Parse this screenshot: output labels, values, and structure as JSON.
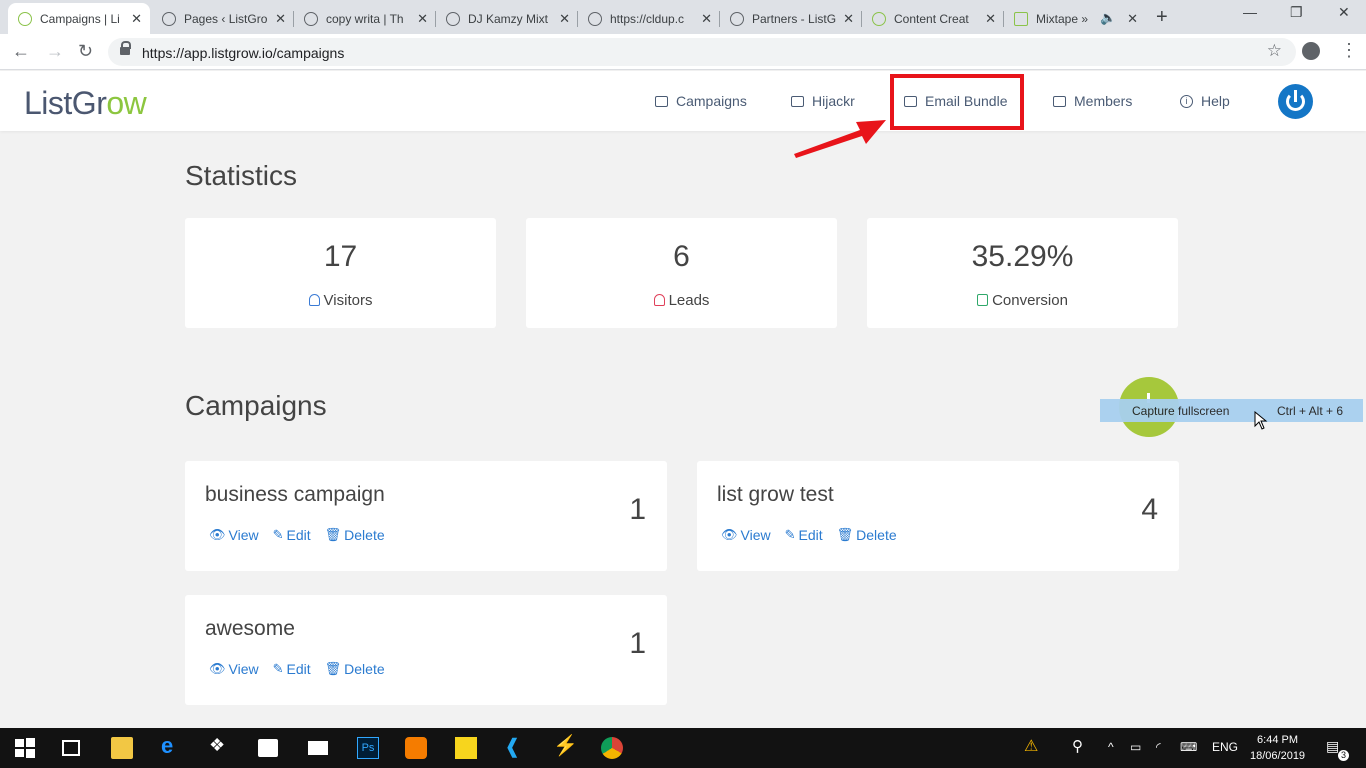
{
  "browser": {
    "tabs": [
      {
        "label": "Campaigns | Li",
        "active": true,
        "icon": "listgrow-favicon"
      },
      {
        "label": "Pages ‹ ListGro",
        "icon": "globe-icon"
      },
      {
        "label": "copy writa | Th",
        "icon": "globe-icon"
      },
      {
        "label": "DJ Kamzy Mixt",
        "icon": "globe-icon"
      },
      {
        "label": "https://cldup.c",
        "icon": "globe-icon"
      },
      {
        "label": "Partners - ListG",
        "icon": "globe-icon"
      },
      {
        "label": "Content Creat",
        "icon": "listgrow-favicon"
      },
      {
        "label": "Mixtape »",
        "icon": "mixtape-favicon"
      }
    ],
    "url": "https://app.listgrow.io/campaigns"
  },
  "app": {
    "logo_part1": "ListGr",
    "logo_part2": "ow",
    "nav": [
      {
        "label": "Campaigns",
        "icon": "campaigns-icon"
      },
      {
        "label": "Hijackr",
        "icon": "camera-icon"
      },
      {
        "label": "Email Bundle",
        "icon": "archive-icon"
      },
      {
        "label": "Members",
        "icon": "id-card-icon"
      },
      {
        "label": "Help",
        "icon": "info-icon"
      }
    ],
    "highlight_color": "#e8141a",
    "accent_color": "#1476c6"
  },
  "statistics": {
    "title": "Statistics",
    "cards": [
      {
        "value": "17",
        "label": "Visitors",
        "icon": "users-icon",
        "icon_color": "#3b7bd5"
      },
      {
        "value": "6",
        "label": "Leads",
        "icon": "user-icon",
        "icon_color": "#e0405a"
      },
      {
        "value": "35.29%",
        "label": "Conversion",
        "icon": "bag-icon",
        "icon_color": "#2fa86a"
      }
    ]
  },
  "campaigns": {
    "title": "Campaigns",
    "items": [
      {
        "name": "business campaign",
        "count": "1"
      },
      {
        "name": "list grow test",
        "count": "4"
      },
      {
        "name": "awesome",
        "count": "1"
      }
    ],
    "actions": {
      "view": "View",
      "edit": "Edit",
      "delete": "Delete"
    }
  },
  "tooltip": {
    "label": "Capture fullscreen",
    "shortcut": "Ctrl + Alt + 6"
  },
  "taskbar": {
    "language": "ENG",
    "time": "6:44 PM",
    "date": "18/06/2019",
    "notifications": "3"
  }
}
